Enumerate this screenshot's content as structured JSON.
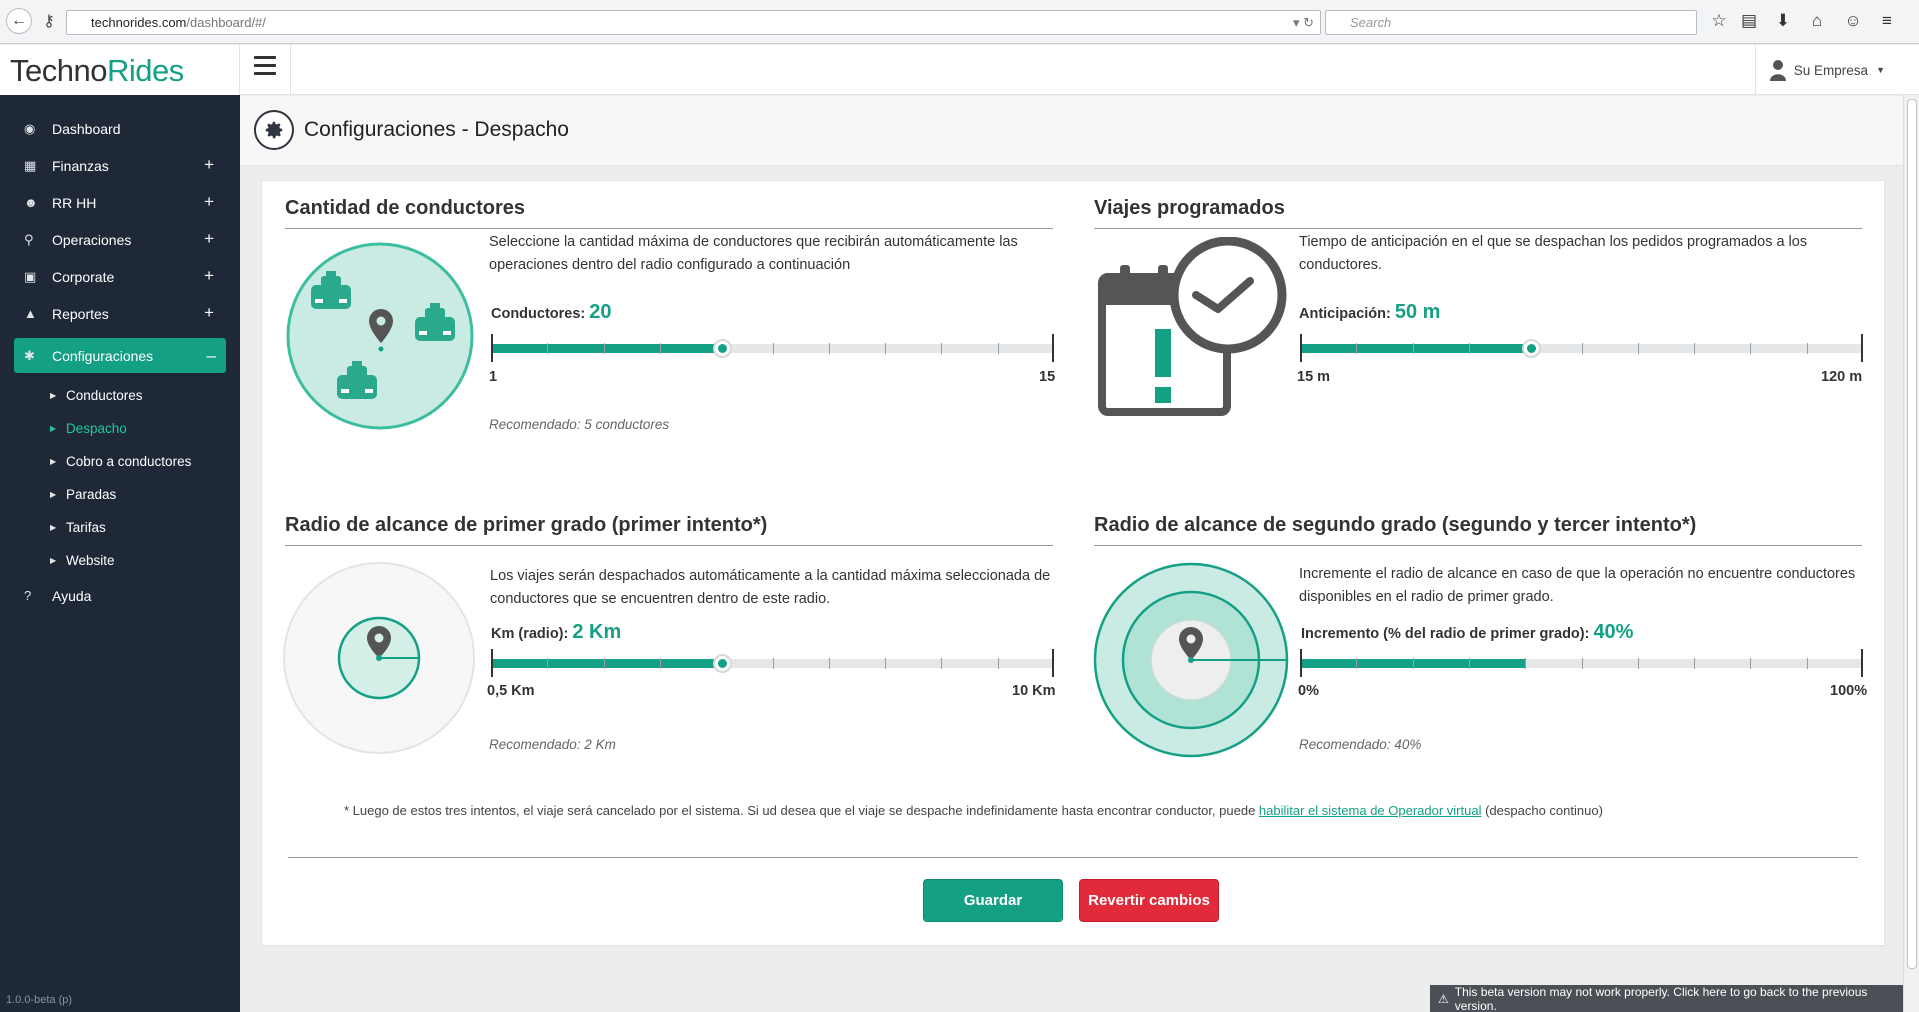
{
  "browser": {
    "url_host": "technorides.com",
    "url_path": "/dashboard/#/",
    "search_placeholder": "Search"
  },
  "app": {
    "logo_part1": "Techno",
    "logo_part2": "Rides",
    "company": "Su Empresa",
    "version": "1.0.0-beta (p)",
    "beta_notice": "This beta version may not work properly. Click here to go back to the previous version."
  },
  "sidebar": {
    "items": [
      {
        "label": "Dashboard",
        "icon": "dashboard-icon",
        "glyph": "◉"
      },
      {
        "label": "Finanzas",
        "icon": "calculator-icon",
        "glyph": "▦",
        "plus": "+"
      },
      {
        "label": "RR HH",
        "icon": "users-icon",
        "glyph": "☻",
        "plus": "+"
      },
      {
        "label": "Operaciones",
        "icon": "map-marker-icon",
        "glyph": "⚲",
        "plus": "+"
      },
      {
        "label": "Corporate",
        "icon": "briefcase-icon",
        "glyph": "▣",
        "plus": "+"
      },
      {
        "label": "Reportes",
        "icon": "chart-icon",
        "glyph": "▲",
        "plus": "+"
      }
    ],
    "active": {
      "label": "Configuraciones",
      "icon": "gear-icon",
      "glyph": "✱",
      "minus": "–"
    },
    "subitems": [
      "Conductores",
      "Despacho",
      "Cobro a conductores",
      "Paradas",
      "Tarifas",
      "Website"
    ],
    "help": {
      "label": "Ayuda",
      "icon": "help-icon",
      "glyph": "?"
    }
  },
  "page": {
    "title": "Configuraciones - Despacho"
  },
  "sections": {
    "drivers": {
      "title": "Cantidad de conductores",
      "description": "Seleccione la cantidad máxima de conductores que recibirán automáticamente las operaciones dentro del radio configurado a continuación",
      "label": "Conductores:",
      "value": "20",
      "min_label": "1",
      "max_label": "15",
      "fill_fraction": 0.41,
      "recommended": "Recomendado: 5 conductores"
    },
    "scheduled": {
      "title": "Viajes programados",
      "description": "Tiempo de anticipación en el que se despachan los pedidos programados a los conductores.",
      "label": "Anticipación:",
      "value": "50 m",
      "min_label": "15 m",
      "max_label": "120 m",
      "fill_fraction": 0.41
    },
    "radius1": {
      "title": "Radio de alcance de primer grado (primer intento*)",
      "description": "Los viajes serán despachados automáticamente a la cantidad máxima seleccionada de conductores que se encuentren dentro de este radio.",
      "label": "Km (radio):",
      "value": "2 Km",
      "min_label": "0,5 Km",
      "max_label": "10 Km",
      "fill_fraction": 0.41,
      "recommended": "Recomendado: 2 Km"
    },
    "radius2": {
      "title": "Radio de alcance de segundo grado (segundo y tercer intento*)",
      "description": "Incremente el radio de alcance en caso de que la operación no encuentre conductores disponibles en el radio de primer grado.",
      "label": "Incremento (% del radio de primer grado):",
      "value": "40%",
      "min_label": "0%",
      "max_label": "100%",
      "fill_fraction": 0.4,
      "recommended": "Recomendado: 40%"
    }
  },
  "footnote": {
    "before": "* Luego de estos tres intentos, el viaje será cancelado por el sistema. Si ud desea que el viaje se despache indefinidamente hasta encontrar conductor, puede ",
    "link": "habilitar el sistema de Operador virtual",
    "after": " (despacho continuo)"
  },
  "buttons": {
    "save": "Guardar",
    "revert": "Revertir cambios"
  },
  "colors": {
    "accent": "#14a085",
    "danger": "#e12b3b",
    "sidebar": "#1f2837"
  }
}
